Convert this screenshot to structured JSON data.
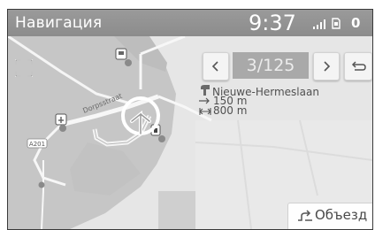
{
  "status_bar": {
    "title": "Навигация",
    "time": "9:37",
    "notification_count": "0"
  },
  "map": {
    "road_label": "Dorpsstraat",
    "road_shield": "A201"
  },
  "route_panel": {
    "step_counter": "3/125",
    "street_name": "Nieuwe-Hermeslaan",
    "distance_next": "150 m",
    "distance_total": "800 m"
  },
  "detour_button": {
    "label": "Объезд"
  },
  "colors": {
    "status_bar": "#8f8f8f",
    "land_dark": "#c4c4c4",
    "land_light": "#e6e6e6",
    "road": "#f7f7f7",
    "counter_bg": "#a9a9a9"
  },
  "icons": [
    "expand-icon",
    "poi-icon",
    "route-arrow-icon",
    "signal-icon",
    "sim-icon",
    "chevron-left-icon",
    "chevron-right-icon",
    "back-arrow-icon",
    "street-turn-icon",
    "distance-icon",
    "detour-icon"
  ]
}
